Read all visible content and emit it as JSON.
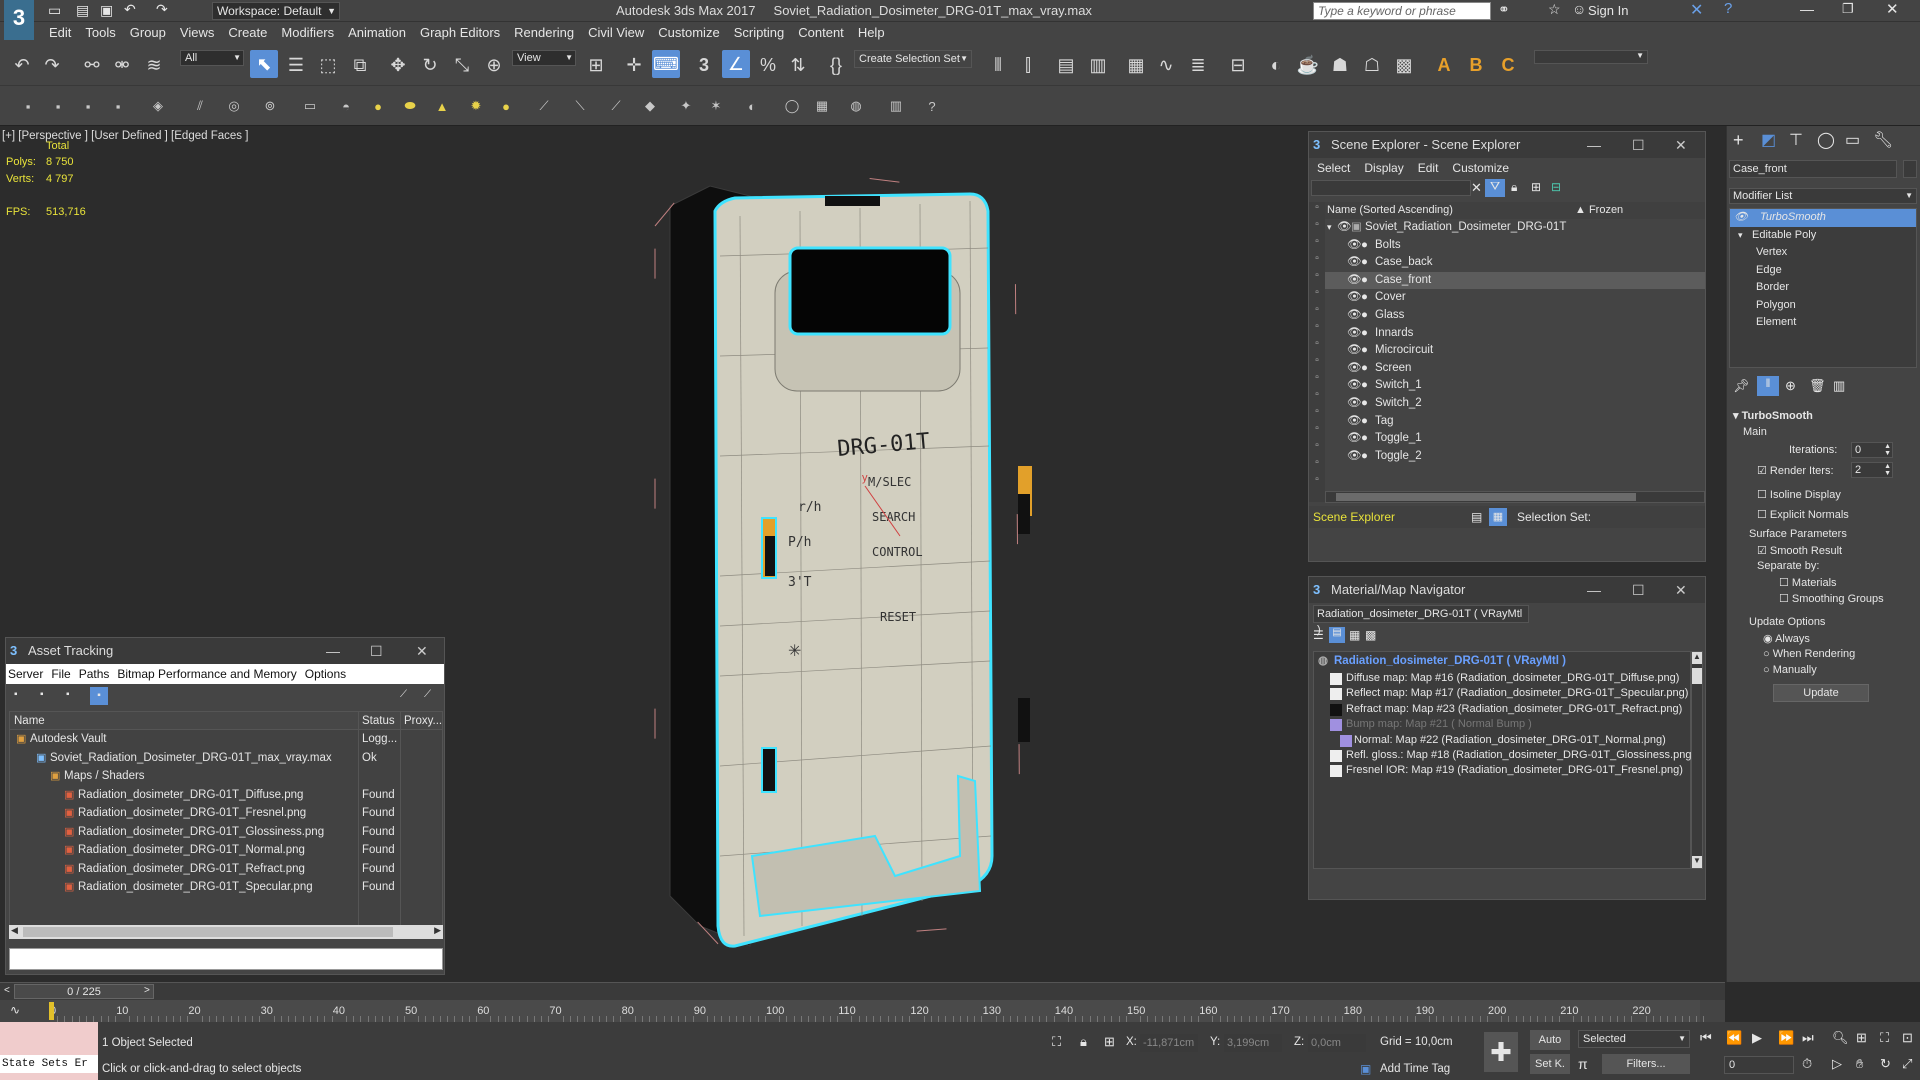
{
  "titlebar": {
    "workspace": "Workspace: Default",
    "title": "Autodesk 3ds Max 2017     Soviet_Radiation_Dosimeter_DRG-01T_max_vray.max",
    "search_placeholder": "Type a keyword or phrase",
    "sign_in": "Sign In"
  },
  "menubar": [
    "Edit",
    "Tools",
    "Group",
    "Views",
    "Create",
    "Modifiers",
    "Animation",
    "Graph Editors",
    "Rendering",
    "Civil View",
    "Customize",
    "Scripting",
    "Content",
    "Help"
  ],
  "toolbar": {
    "filter": "All",
    "view": "View",
    "selection_set": "Create Selection Set"
  },
  "viewport": {
    "label": "[+] [Perspective ] [User Defined ] [Edged Faces ]",
    "stats_total": "Total",
    "polys_label": "Polys:",
    "polys_value": "8 750",
    "verts_label": "Verts:",
    "verts_value": "4 797",
    "fps_label": "FPS:",
    "fps_value": "513,716",
    "model_text": {
      "name": "DRG-01T",
      "l1": "r/h",
      "l2": "P/h",
      "l3": "3'T",
      "r1": "M/SLEC",
      "r2": "SEARCH",
      "r3": "CONTROL",
      "r4": "RESET",
      "star": "✳",
      "axis_y": "y"
    }
  },
  "scene_explorer": {
    "title": "Scene Explorer - Scene Explorer",
    "menu": [
      "Select",
      "Display",
      "Edit",
      "Customize"
    ],
    "col_name": "Name (Sorted Ascending)",
    "col_frozen": "▲ Frozen",
    "root": "Soviet_Radiation_Dosimeter_DRG-01T",
    "items": [
      "Bolts",
      "Case_back",
      "Case_front",
      "Cover",
      "Glass",
      "Innards",
      "Microcircuit",
      "Screen",
      "Switch_1",
      "Switch_2",
      "Tag",
      "Toggle_1",
      "Toggle_2"
    ],
    "selected": "Case_front",
    "footer_label": "Scene Explorer",
    "selection_set": "Selection Set:"
  },
  "material_nav": {
    "title": "Material/Map Navigator",
    "current": "Radiation_dosimeter_DRG-01T  ( VRayMtl )",
    "root": "Radiation_dosimeter_DRG-01T  ( VRayMtl )",
    "maps": [
      "Diffuse map: Map #16 (Radiation_dosimeter_DRG-01T_Diffuse.png)",
      "Reflect map: Map #17 (Radiation_dosimeter_DRG-01T_Specular.png)",
      "Refract map: Map #23 (Radiation_dosimeter_DRG-01T_Refract.png)",
      "Bump map: Map #21  ( Normal Bump )",
      "Normal: Map #22 (Radiation_dosimeter_DRG-01T_Normal.png)",
      "Refl. gloss.: Map #18 (Radiation_dosimeter_DRG-01T_Glossiness.png)",
      "Fresnel IOR: Map #19 (Radiation_dosimeter_DRG-01T_Fresnel.png)"
    ]
  },
  "asset_tracking": {
    "title": "Asset Tracking",
    "menu": [
      "Server",
      "File",
      "Paths",
      "Bitmap Performance and Memory",
      "Options"
    ],
    "col_name": "Name",
    "col_status": "Status",
    "col_proxy": "Proxy...",
    "rows": [
      {
        "name": "Autodesk Vault",
        "status": "Logg..."
      },
      {
        "name": "Soviet_Radiation_Dosimeter_DRG-01T_max_vray.max",
        "status": "Ok"
      },
      {
        "name": "Maps / Shaders",
        "status": ""
      },
      {
        "name": "Radiation_dosimeter_DRG-01T_Diffuse.png",
        "status": "Found"
      },
      {
        "name": "Radiation_dosimeter_DRG-01T_Fresnel.png",
        "status": "Found"
      },
      {
        "name": "Radiation_dosimeter_DRG-01T_Glossiness.png",
        "status": "Found"
      },
      {
        "name": "Radiation_dosimeter_DRG-01T_Normal.png",
        "status": "Found"
      },
      {
        "name": "Radiation_dosimeter_DRG-01T_Refract.png",
        "status": "Found"
      },
      {
        "name": "Radiation_dosimeter_DRG-01T_Specular.png",
        "status": "Found"
      }
    ]
  },
  "command_panel": {
    "object_name": "Case_front",
    "modifier_list": "Modifier List",
    "stack": [
      "TurboSmooth",
      "Editable Poly",
      "Vertex",
      "Edge",
      "Border",
      "Polygon",
      "Element"
    ],
    "rollout": "TurboSmooth",
    "main": "Main",
    "iterations_label": "Iterations:",
    "iterations": "0",
    "render_iters_label": "Render Iters:",
    "render_iters": "2",
    "isoline": "Isoline Display",
    "explicit_normals": "Explicit Normals",
    "surface_params": "Surface Parameters",
    "smooth_result": "Smooth Result",
    "separate_by": "Separate by:",
    "materials": "Materials",
    "smoothing_groups": "Smoothing Groups",
    "update_options": "Update Options",
    "always": "Always",
    "when_rendering": "When Rendering",
    "manually": "Manually",
    "update_btn": "Update"
  },
  "timeline": {
    "frame": "0 / 225",
    "ticks": [
      "0",
      "10",
      "20",
      "30",
      "40",
      "50",
      "60",
      "70",
      "80",
      "90",
      "100",
      "110",
      "120",
      "130",
      "140",
      "150",
      "160",
      "170",
      "180",
      "190",
      "200",
      "210",
      "220"
    ]
  },
  "status": {
    "selected": "1 Object Selected",
    "prompt": "Click or click-and-drag to select objects",
    "state_sets": "State Sets Er",
    "x_label": "X:",
    "x_value": "-11,871cm",
    "y_label": "Y:",
    "y_value": "3,199cm",
    "z_label": "Z:",
    "z_value": "0,0cm",
    "grid": "Grid = 10,0cm",
    "auto": "Auto",
    "set_k": "Set K.",
    "selected_dd": "Selected",
    "filters": "Filters...",
    "add_time_tag": "Add Time Tag",
    "frame_field": "0"
  },
  "colors": {
    "accent": "#5a8fd6",
    "selection_cyan": "#3fe3ff",
    "case": "#d2cfc0",
    "text_yellow": "#e8e23a"
  }
}
